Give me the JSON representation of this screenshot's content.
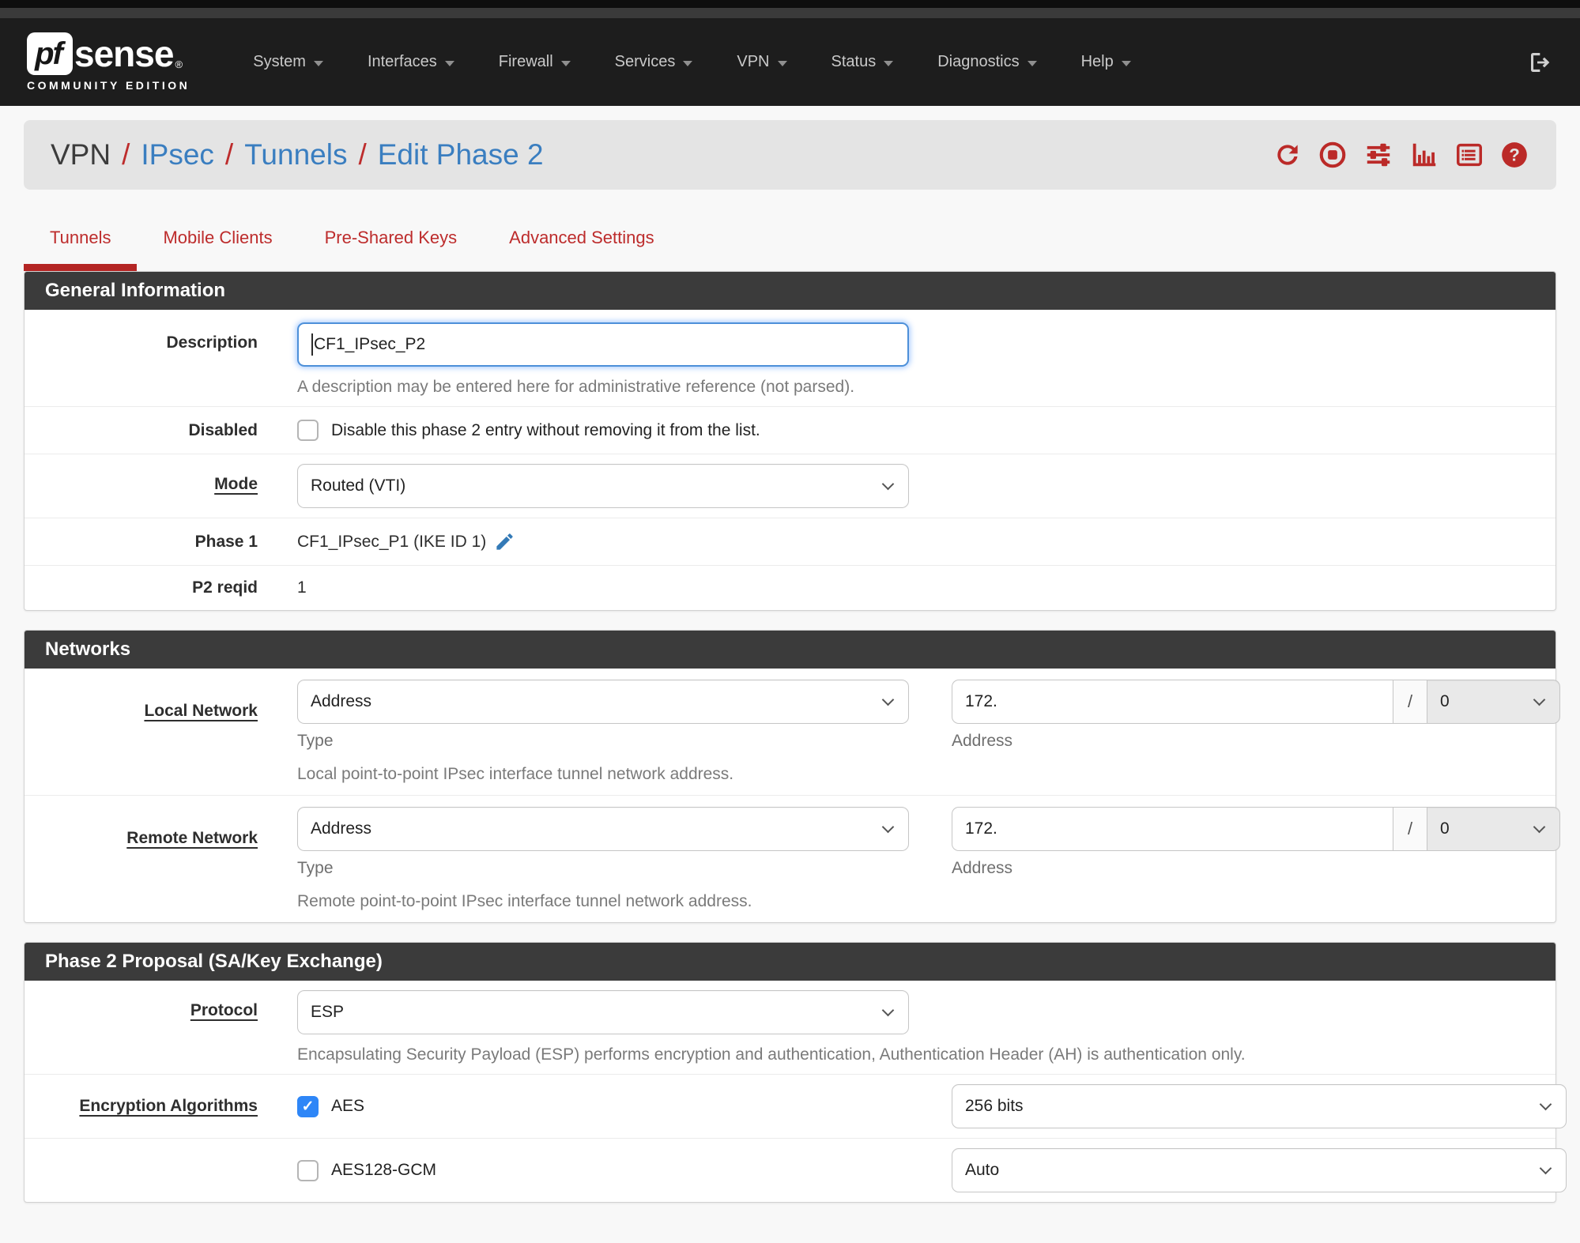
{
  "navbar": {
    "brand_pf": "pf",
    "brand_sense": "sense",
    "brand_reg": "®",
    "brand_subtitle": "COMMUNITY EDITION",
    "items": [
      {
        "label": "System"
      },
      {
        "label": "Interfaces"
      },
      {
        "label": "Firewall"
      },
      {
        "label": "Services"
      },
      {
        "label": "VPN"
      },
      {
        "label": "Status"
      },
      {
        "label": "Diagnostics"
      },
      {
        "label": "Help"
      }
    ]
  },
  "breadcrumb": {
    "current": "VPN",
    "sep": "/",
    "link_ipsec": "IPsec",
    "link_tunnels": "Tunnels",
    "link_edit": "Edit Phase 2",
    "action_icons": [
      "refresh",
      "stop-circle",
      "sliders",
      "bar-chart",
      "list-alt",
      "question-circle"
    ]
  },
  "tabs": [
    {
      "label": "Tunnels",
      "active": true
    },
    {
      "label": "Mobile Clients",
      "active": false
    },
    {
      "label": "Pre-Shared Keys",
      "active": false
    },
    {
      "label": "Advanced Settings",
      "active": false
    }
  ],
  "sections": {
    "general": {
      "title": "General Information",
      "description": {
        "label": "Description",
        "value": "CF1_IPsec_P2",
        "help": "A description may be entered here for administrative reference (not parsed)."
      },
      "disabled": {
        "label": "Disabled",
        "checkbox_label": "Disable this phase 2 entry without removing it from the list."
      },
      "mode": {
        "label": "Mode",
        "value": "Routed (VTI)"
      },
      "phase1": {
        "label": "Phase 1",
        "value": "CF1_IPsec_P1 (IKE ID 1)"
      },
      "p2reqid": {
        "label": "P2 reqid",
        "value": "1"
      }
    },
    "networks": {
      "title": "Networks",
      "local": {
        "label": "Local Network",
        "type_value": "Address",
        "type_caption": "Type",
        "address_value": "172.",
        "address_caption": "Address",
        "slash": "/",
        "prefix_value": "0",
        "help": "Local point-to-point IPsec interface tunnel network address."
      },
      "remote": {
        "label": "Remote Network",
        "type_value": "Address",
        "type_caption": "Type",
        "address_value": "172.",
        "address_caption": "Address",
        "slash": "/",
        "prefix_value": "0",
        "help": "Remote point-to-point IPsec interface tunnel network address."
      }
    },
    "proposal": {
      "title": "Phase 2 Proposal (SA/Key Exchange)",
      "protocol": {
        "label": "Protocol",
        "value": "ESP",
        "help": "Encapsulating Security Payload (ESP) performs encryption and authentication, Authentication Header (AH) is authentication only."
      },
      "encryption": {
        "label": "Encryption Algorithms",
        "rows": [
          {
            "name": "AES",
            "checked": true,
            "bits": "256 bits"
          },
          {
            "name": "AES128-GCM",
            "checked": false,
            "bits": "Auto"
          }
        ]
      }
    }
  },
  "colors": {
    "accent_red": "#bd2c2c",
    "link_blue": "#3a7ec0",
    "checkbox_blue": "#2e86f7",
    "header_dark": "#3b3b3b"
  }
}
